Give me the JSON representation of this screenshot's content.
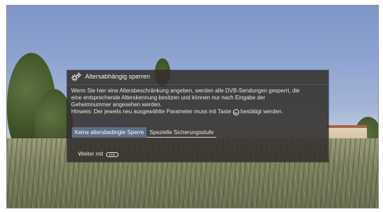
{
  "dialog": {
    "title": "Altersabhängig sperren",
    "body_line1": "Wenn Sie hier eine Altersbeschränkung angeben, werden alle DVB-Sendungen gesperrt, die",
    "body_line2": "eine entsprechende Alterskennung besitzen und können nur nach Eingabe der",
    "body_line3": "Geheimnummer angesehen werden.",
    "hint_prefix": "Hinweis: Der jeweils neu ausgewählte Parameter muss mit Taste",
    "hint_suffix": "bestätigt werden.",
    "ok_key_label": "OK",
    "options": [
      {
        "label": "Keine altersbedingte Sperre",
        "selected": true
      },
      {
        "label": "Spezielle Sicherungsstufe",
        "selected": false
      }
    ],
    "footer_label": "Weiter mit"
  },
  "icons": {
    "header_icon": "gear-icon",
    "ok_key": "ok-button-icon",
    "forward_key": "forward-key-icon"
  },
  "colors": {
    "dialog_background": "#34302c",
    "selected_option": "#5f6d86",
    "text": "#ececec"
  }
}
